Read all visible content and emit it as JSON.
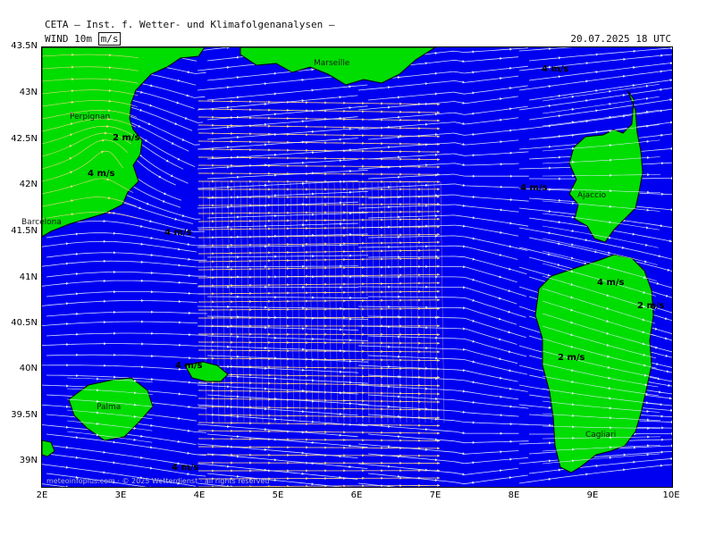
{
  "header": {
    "title": "CETA – Inst. f. Wetter- und Klimafolgenanalysen –",
    "variable": "WIND 10m",
    "unit": "m/s",
    "datetime": "20.07.2025 18 UTC"
  },
  "axes": {
    "lat_labels": [
      "43.5N",
      "43N",
      "42.5N",
      "42N",
      "41.5N",
      "41N",
      "40.5N",
      "40N",
      "39.5N",
      "39N"
    ],
    "lon_labels": [
      "2E",
      "3E",
      "4E",
      "5E",
      "6E",
      "7E",
      "8E",
      "9E",
      "10E"
    ]
  },
  "cities": [
    {
      "id": "perpignan",
      "name": "Perpignan"
    },
    {
      "id": "barcelona",
      "name": "Barcelona"
    },
    {
      "id": "marseille",
      "name": "Marseille"
    },
    {
      "id": "ajaccio",
      "name": "Ajaccio"
    },
    {
      "id": "palma",
      "name": "Palma"
    },
    {
      "id": "cagliari",
      "name": "Cagliari"
    }
  ],
  "speed_labels": [
    "2 m/s",
    "4 m/s",
    "4 m/s",
    "4 m/s",
    "4 m/s",
    "4 m/s",
    "4 m/s",
    "2 m/s",
    "2 m/s",
    "4 m/s"
  ],
  "credit": "meteoinfoplus.com · © 2025 Wetterdienst · all rights reserved",
  "colors": {
    "sea": "#0000f0",
    "land": "#00dd00",
    "coast": "#000000",
    "streamline_light": "#e6f0ff",
    "streamline_warm": "#ffd98a"
  }
}
